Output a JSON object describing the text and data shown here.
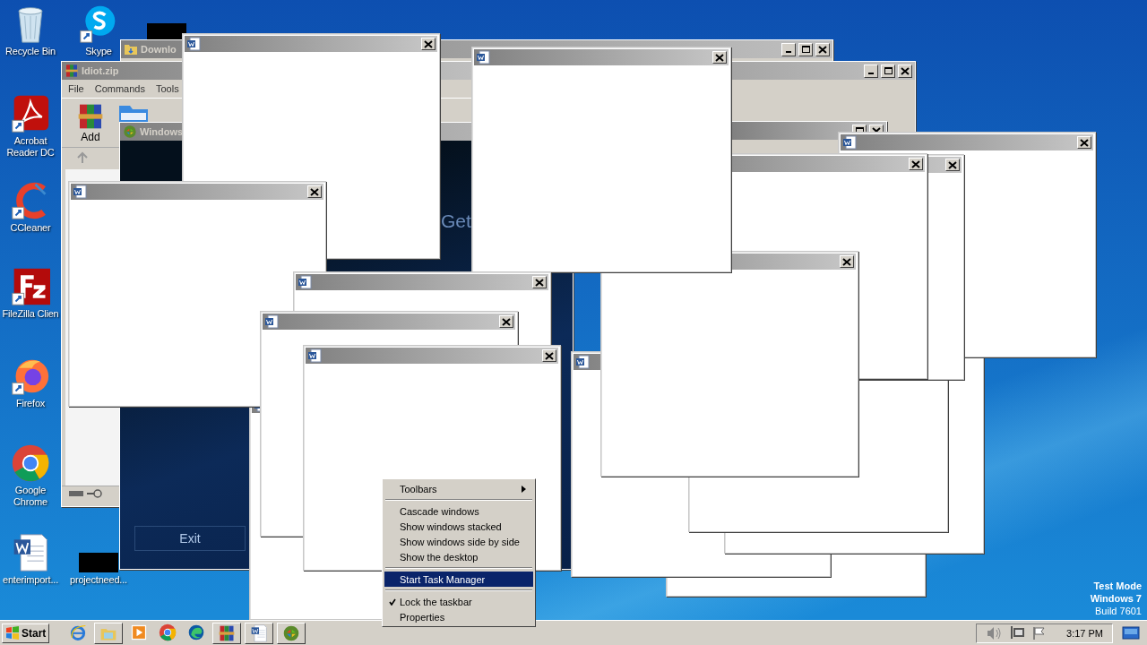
{
  "desktop_icons": [
    {
      "label": "Recycle Bin",
      "kind": "recycle"
    },
    {
      "label": "Skype",
      "kind": "skype"
    },
    {
      "label": "Acrobat Reader DC",
      "kind": "acrobat"
    },
    {
      "label": "CCleaner",
      "kind": "ccleaner"
    },
    {
      "label": "FileZilla Clien",
      "kind": "filezilla"
    },
    {
      "label": "Firefox",
      "kind": "firefox"
    },
    {
      "label": "Google Chrome",
      "kind": "chrome"
    },
    {
      "label": "enterimport...",
      "kind": "word"
    },
    {
      "label": "projectneed...",
      "kind": "thumb"
    },
    {
      "kind": "thumb"
    }
  ],
  "background_windows": [
    {
      "kind": "folder",
      "title": "Downlo"
    },
    {
      "kind": "plain"
    },
    {
      "kind": "plain"
    },
    {
      "kind": "archive",
      "title": "Idiot.zip",
      "menu": [
        "File",
        "Commands",
        "Tools"
      ],
      "toolbar": [
        "Add"
      ]
    },
    {
      "kind": "setup",
      "title": "Windows",
      "heading": "Get",
      "button": "Exit"
    }
  ],
  "popups": [
    {
      "kind": "blank"
    },
    {
      "kind": "blank"
    },
    {
      "kind": "blank"
    },
    {
      "kind": "blank"
    },
    {
      "kind": "blank"
    },
    {
      "kind": "blank"
    },
    {
      "kind": "blank"
    },
    {
      "kind": "blank"
    },
    {
      "kind": "blank"
    },
    {
      "kind": "blank"
    },
    {
      "kind": "blank"
    },
    {
      "kind": "blank"
    },
    {
      "kind": "blank"
    },
    {
      "kind": "blank"
    },
    {
      "kind": "blank"
    }
  ],
  "context_menu": {
    "items": [
      {
        "kind": "submenu",
        "label": "Toolbars",
        "selected": false,
        "checked": false
      },
      {
        "kind": "separator"
      },
      {
        "kind": "item",
        "label": "Cascade windows",
        "selected": false,
        "checked": false
      },
      {
        "kind": "item",
        "label": "Show windows stacked",
        "selected": false,
        "checked": false
      },
      {
        "kind": "item",
        "label": "Show windows side by side",
        "selected": false,
        "checked": false
      },
      {
        "kind": "item",
        "label": "Show the desktop",
        "selected": false,
        "checked": false
      },
      {
        "kind": "separator"
      },
      {
        "kind": "item",
        "label": "Start Task Manager",
        "selected": true,
        "checked": false
      },
      {
        "kind": "separator"
      },
      {
        "kind": "item",
        "label": "Lock the taskbar",
        "selected": false,
        "checked": true
      },
      {
        "kind": "item",
        "label": "Properties",
        "selected": false,
        "checked": false
      }
    ]
  },
  "desktop_notice": [
    "Test Mode",
    "Windows 7",
    "Build 7601"
  ],
  "taskbar": {
    "start": "Start",
    "buttons": [
      {
        "kind": "ie",
        "running": false
      },
      {
        "kind": "explorer",
        "running": true
      },
      {
        "kind": "media",
        "running": false
      },
      {
        "kind": "chrome",
        "running": false
      },
      {
        "kind": "edge",
        "running": false
      },
      {
        "kind": "winrar",
        "running": true
      },
      {
        "kind": "word",
        "running": true
      },
      {
        "kind": "setup",
        "running": true
      }
    ],
    "clock": "3:17 PM"
  }
}
